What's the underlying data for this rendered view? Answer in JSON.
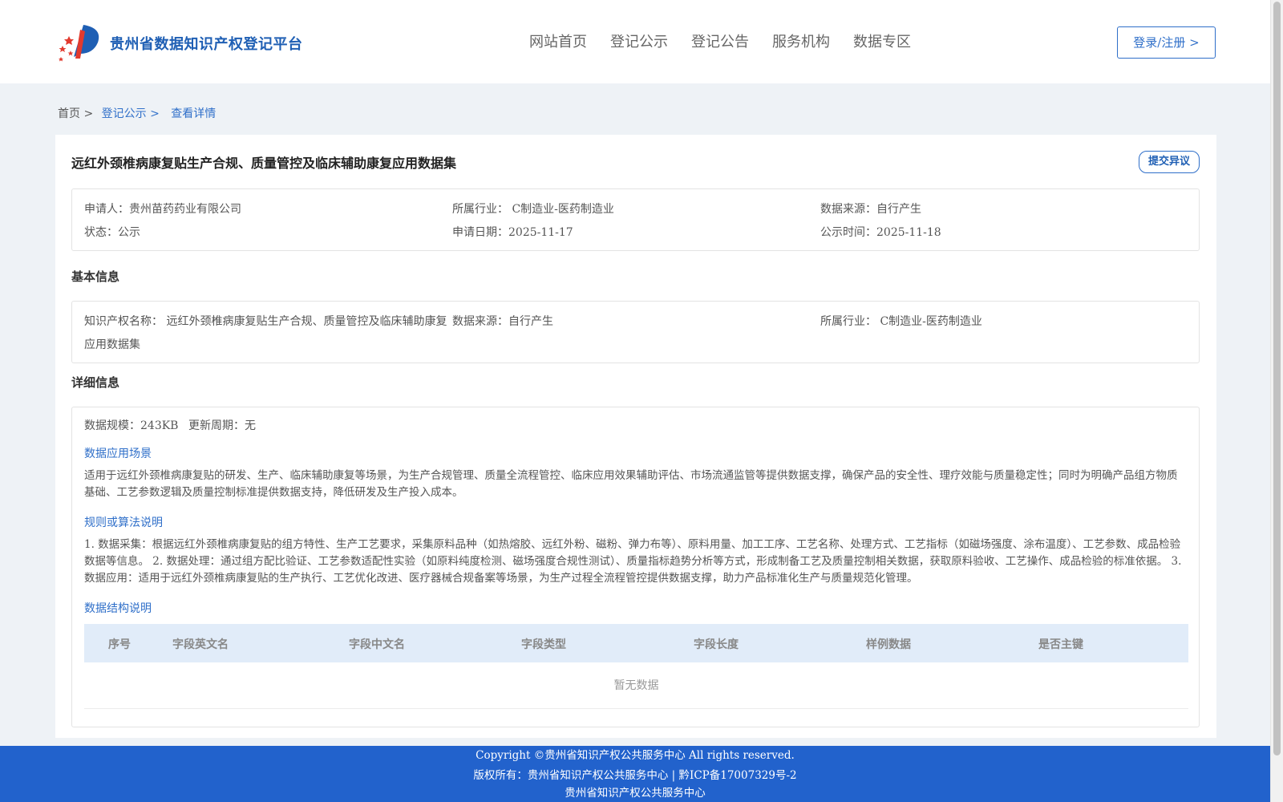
{
  "header": {
    "site_title": "贵州省数据知识产权登记平台",
    "nav": [
      "网站首页",
      "登记公示",
      "登记公告",
      "服务机构",
      "数据专区"
    ],
    "login_label": "登录/注册 >"
  },
  "breadcrumb": {
    "home": "首页 >",
    "list": "登记公示 >",
    "current": "查看详情"
  },
  "record": {
    "title": "远红外颈椎病康复贴生产合规、质量管控及临床辅助康复应用数据集",
    "objection_label": "提交异议",
    "summary": {
      "applicant": "申请人：贵州苗药药业有限公司",
      "industry": "所属行业： C制造业-医药制造业",
      "data_source": "数据来源：自行产生",
      "status": "状态：公示",
      "apply_date": "申请日期：2025-11-17",
      "publish_date": "公示时间：2025-11-18"
    }
  },
  "basic": {
    "section_title": "基本信息",
    "ip_name_line1": "知识产权名称： 远红外颈椎病康复贴生产合规、质量管控及临床辅助康复",
    "ip_name_line2": "应用数据集",
    "data_source": "数据来源：自行产生",
    "industry": "所属行业： C制造业-医药制造业"
  },
  "detail": {
    "section_title": "详细信息",
    "scale": "数据规模：243KB",
    "update_cycle": "更新周期：无",
    "scenario_title": "数据应用场景",
    "scenario_text": "适用于远红外颈椎病康复贴的研发、生产、临床辅助康复等场景，为生产合规管理、质量全流程管控、临床应用效果辅助评估、市场流通监管等提供数据支撑，确保产品的安全性、理疗效能与质量稳定性；同时为明确产品组方物质基础、工艺参数逻辑及质量控制标准提供数据支持，降低研发及生产投入成本。",
    "rules_title": "规则或算法说明",
    "rules_text": "1. 数据采集：根据远红外颈椎病康复贴的组方特性、生产工艺要求，采集原料品种（如热熔胶、远红外粉、磁粉、弹力布等）、原料用量、加工工序、工艺名称、处理方式、工艺指标（如磁场强度、涂布温度）、工艺参数、成品检验数据等信息。 2. 数据处理：通过组方配比验证、工艺参数适配性实验（如原料纯度检测、磁场强度合规性测试）、质量指标趋势分析等方式，形成制备工艺及质量控制相关数据，获取原料验收、工艺操作、成品检验的标准依据。 3. 数据应用：适用于远红外颈椎病康复贴的生产执行、工艺优化改进、医疗器械合规备案等场景，为生产过程全流程管控提供数据支撑，助力产品标准化生产与质量规范化管理。",
    "structure_title": "数据结构说明",
    "table_headers": [
      "序号",
      "字段英文名",
      "字段中文名",
      "字段类型",
      "字段长度",
      "样例数据",
      "是否主键"
    ],
    "empty_text": "暂无数据"
  },
  "footer": {
    "copyright": "Copyright ©贵州省知识产权公共服务中心 All rights reserved.",
    "owner": "版权所有：贵州省知识产权公共服务中心 | 黔ICP备17007329号-2",
    "org": "贵州省知识产权公共服务中心"
  },
  "colors": {
    "brand_blue": "#2f6fc9",
    "footer_blue": "#2262cc",
    "table_head_bg": "#e1ecf9"
  }
}
